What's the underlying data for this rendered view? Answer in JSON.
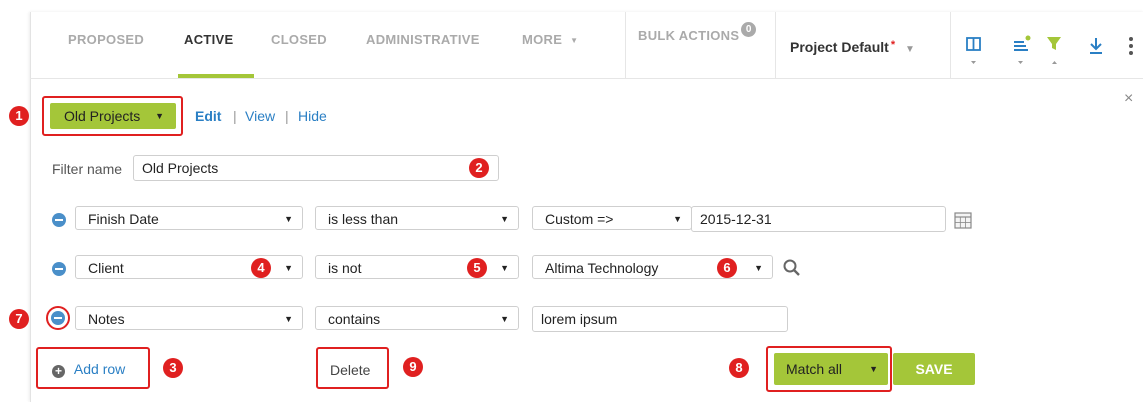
{
  "tabs": [
    {
      "label": "PROPOSED"
    },
    {
      "label": "ACTIVE"
    },
    {
      "label": "CLOSED"
    },
    {
      "label": "ADMINISTRATIVE"
    },
    {
      "label": "MORE"
    }
  ],
  "toolbar": {
    "bulk_actions_label": "BULK ACTIONS",
    "bulk_actions_count": "0",
    "view_name": "Project Default",
    "view_modified_marker": "*"
  },
  "filter_panel": {
    "saved_filter_value": "Old Projects",
    "edit_link": "Edit",
    "view_link": "View",
    "hide_link": "Hide",
    "separator": "|",
    "close_symbol": "×",
    "filter_name_label": "Filter name",
    "filter_name_value": "Old Projects",
    "rows": [
      {
        "field": "Finish Date",
        "operator": "is less than",
        "value_mode": "Custom =>",
        "value": "2015-12-31"
      },
      {
        "field": "Client",
        "operator": "is not",
        "value": "Altima Technology"
      },
      {
        "field": "Notes",
        "operator": "contains",
        "value": "lorem ipsum"
      }
    ],
    "add_row_label": "Add row",
    "delete_label": "Delete",
    "match_value": "Match all",
    "save_label": "SAVE"
  },
  "callouts": [
    "1",
    "2",
    "3",
    "4",
    "5",
    "6",
    "7",
    "8",
    "9"
  ],
  "colors": {
    "accent_green": "#a4c639",
    "link_blue": "#2a7fc4",
    "callout_red": "#e02020"
  }
}
